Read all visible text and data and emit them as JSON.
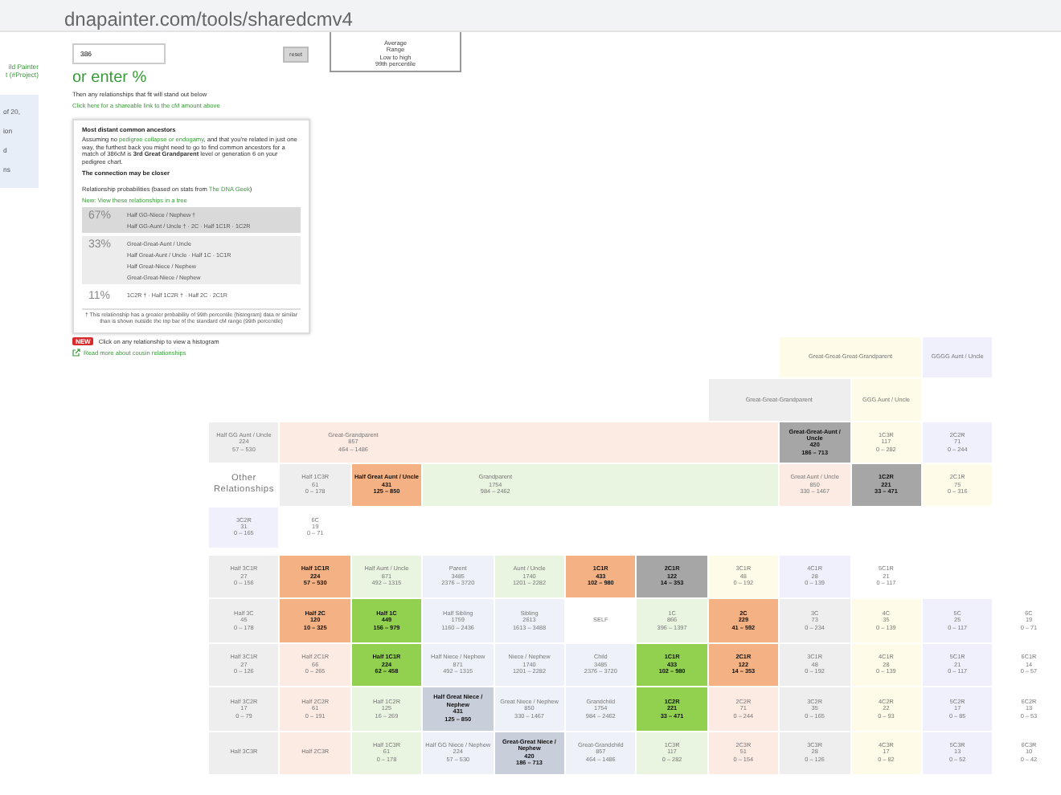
{
  "address_bar": {
    "url": "dnapainter.com/tools/sharedcmv4"
  },
  "sidebar": {
    "links": [
      "ild Painter",
      "t (#Project)"
    ],
    "panel_lines": [
      "of 20,",
      "ion",
      "d",
      "ns"
    ]
  },
  "calculator": {
    "cm_input": {
      "value": "386"
    },
    "reset_button": "reset",
    "legend_lines": [
      "Average",
      "Range",
      "Low to high",
      "99th percentile"
    ],
    "percent_heading": "or enter %",
    "instruction": "Then any relationships that fit will stand out below",
    "share_link": "Click here for a shareable link to the cM amount above",
    "ancestors_box": {
      "title": "Most distant common ancestors",
      "assumption": {
        "before": "Assuming no ",
        "link": "pedigree collapse or endogamy",
        "after": ", and that you're related in just one way, the furthest back you might need to go to find common ancestors for a match of 386cM is **3rd Great Grandparent** level or generation 6 on your pedigree chart."
      },
      "closer_note": "The connection may be closer",
      "probabilities_heading": {
        "before": "Relationship probabilities (based on stats from ",
        "link": "The DNA Geek",
        "after": ")"
      },
      "tree_link": "New: View these relationships in a tree",
      "groups": [
        {
          "percent": "67%",
          "color": "#d9d9d9",
          "lines": [
            "Half GG-Niece / Nephew †",
            "Half GG-Aunt / Uncle †  ·  2C  ·  Half 1C1R  ·  1C2R"
          ]
        },
        {
          "percent": "33%",
          "color": "#ececec",
          "lines": [
            "Great-Great-Aunt / Uncle",
            "Half Great-Aunt / Uncle  ·  Half 1C  ·  1C1R",
            "Half Great-Niece / Nephew",
            "Great-Great-Niece / Nephew"
          ]
        },
        {
          "percent": "11%",
          "color": "#ffffff",
          "lines": [
            "1C2R †  ·  Half 1C2R †  ·  Half 2C  ·  2C1R"
          ]
        }
      ],
      "footnote": "† This relationship has a greater probability of 99th percentile (histogram) data or similar than is shown outside the top bar of the standard cM range (99th percentile)"
    },
    "new_badge": "NEW",
    "histogram_hint": "Click on any relationship to view a histogram",
    "read_more_link": "Read more about cousin relationships"
  },
  "grid": {
    "other_label": "Other Relationships",
    "rows": [
      {
        "cells": [
          null,
          null,
          null,
          null,
          null,
          null,
          null,
          null,
          {
            "name": "Great-Great-Great-Grandparent",
            "color": "#fefbe9",
            "highlighted": false
          },
          null,
          {
            "name": "GGGG Aunt / Uncle",
            "color": "#f0f0fc",
            "highlighted": false
          }
        ]
      },
      {
        "cells": [
          null,
          null,
          null,
          null,
          null,
          null,
          null,
          {
            "name": "Great-Great-Grandparent",
            "color": "#eeeeee",
            "highlighted": false
          },
          null,
          {
            "name": "GGG Aunt / Uncle",
            "color": "#fefbe9",
            "highlighted": false
          }
        ]
      },
      {
        "cells": [
          {
            "name": "Half GG Aunt / Uncle",
            "cm": "224",
            "range": "57 – 530",
            "color": "#eeeeee",
            "highlighted": false
          },
          {
            "name": "Great-Grandparent",
            "cm": "857",
            "range": "464 – 1486",
            "color": "#fcebe3",
            "highlighted": false
          },
          null,
          null,
          null,
          null,
          null,
          null,
          {
            "name": "Great-Great-Aunt / Uncle",
            "cm": "420",
            "range": "186 – 713",
            "color": "#a6a6a6",
            "highlighted": true
          },
          {
            "name": "1C3R",
            "cm": "117",
            "range": "0 – 282",
            "color": "#fefbe9",
            "highlighted": false
          },
          {
            "name": "2C2R",
            "cm": "71",
            "range": "0 – 244",
            "color": "#f0f0fc",
            "highlighted": false
          }
        ]
      },
      {
        "cells": [
          null,
          {
            "name": "Half 1C3R",
            "cm": "61",
            "range": "0 – 178",
            "color": "#eeeeee",
            "highlighted": false
          },
          {
            "name": "Half Great Aunt / Uncle",
            "cm": "431",
            "range": "125 – 850",
            "color": "#f4b183",
            "highlighted": true
          },
          {
            "name": "Grandparent",
            "cm": "1754",
            "range": "984 – 2462",
            "color": "#eaf5e1",
            "highlighted": false
          },
          null,
          null,
          null,
          null,
          {
            "name": "Great Aunt / Uncle",
            "cm": "850",
            "range": "330 – 1467",
            "color": "#fcebe3",
            "highlighted": false
          },
          {
            "name": "1C2R",
            "cm": "221",
            "range": "33 – 471",
            "color": "#a6a6a6",
            "highlighted": true
          },
          {
            "name": "2C1R",
            "cm": "75",
            "range": "0 – 316",
            "color": "#fefbe9",
            "highlighted": false
          }
        ]
      },
      {
        "cells": [
          {
            "name": "3C2R",
            "cm": "31",
            "range": "0 – 165",
            "color": "#f0f0fc",
            "highlighted": false
          },
          {
            "name": "6C",
            "cm": "19",
            "range": "0 – 71",
            "color": "#ffffff",
            "highlighted": false
          }
        ]
      },
      {
        "cells": [
          {
            "name": "Half 3C1R",
            "cm": "27",
            "range": "0 – 156",
            "color": "#eeeeee",
            "highlighted": false
          },
          {
            "name": "Half 1C1R",
            "cm": "224",
            "range": "57 – 530",
            "color": "#f4b183",
            "highlighted": true
          },
          {
            "name": "Half Aunt / Uncle",
            "cm": "871",
            "range": "492 – 1315",
            "color": "#eaf5e1",
            "highlighted": false
          },
          {
            "name": "Parent",
            "cm": "3485",
            "range": "2376 – 3720",
            "color": "#eef2f8",
            "highlighted": false
          },
          {
            "name": "Aunt / Uncle",
            "cm": "1740",
            "range": "1201 – 2282",
            "color": "#eaf5e1",
            "highlighted": false
          },
          {
            "name": "1C1R",
            "cm": "433",
            "range": "102 – 980",
            "color": "#f4b183",
            "highlighted": true
          },
          {
            "name": "2C1R",
            "cm": "122",
            "range": "14 – 353",
            "color": "#a6a6a6",
            "highlighted": true
          },
          {
            "name": "3C1R",
            "cm": "48",
            "range": "0 – 192",
            "color": "#fefbe9",
            "highlighted": false
          },
          {
            "name": "4C1R",
            "cm": "28",
            "range": "0 – 139",
            "color": "#f0f0fc",
            "highlighted": false
          },
          {
            "name": "5C1R",
            "cm": "21",
            "range": "0 – 117",
            "color": "#ffffff",
            "highlighted": false
          }
        ]
      },
      {
        "cells": [
          {
            "name": "Half 3C",
            "cm": "45",
            "range": "0 – 178",
            "color": "#eeeeee",
            "highlighted": false
          },
          {
            "name": "Half 2C",
            "cm": "120",
            "range": "10 – 325",
            "color": "#f4b183",
            "highlighted": true
          },
          {
            "name": "Half 1C",
            "cm": "449",
            "range": "156 – 979",
            "color": "#92d050",
            "highlighted": true
          },
          {
            "name": "Half Sibling",
            "cm": "1759",
            "range": "1160 – 2436",
            "color": "#eef2f8",
            "highlighted": false
          },
          {
            "name": "Sibling",
            "cm": "2613",
            "range": "1613 – 3488",
            "color": "#eef2f8",
            "highlighted": false
          },
          {
            "name": "SELF",
            "color": "#ffffff",
            "highlighted": false
          },
          {
            "name": "1C",
            "cm": "866",
            "range": "396 – 1397",
            "color": "#eaf5e1",
            "highlighted": false
          },
          {
            "name": "2C",
            "cm": "229",
            "range": "41 – 592",
            "color": "#f4b183",
            "highlighted": true
          },
          {
            "name": "3C",
            "cm": "73",
            "range": "0 – 234",
            "color": "#eeeeee",
            "highlighted": false
          },
          {
            "name": "4C",
            "cm": "35",
            "range": "0 – 139",
            "color": "#fefbe9",
            "highlighted": false
          },
          {
            "name": "5C",
            "cm": "25",
            "range": "0 – 117",
            "color": "#f0f0fc",
            "highlighted": false
          },
          {
            "name": "6C",
            "cm": "19",
            "range": "0 – 71",
            "color": "#ffffff",
            "highlighted": false
          }
        ]
      },
      {
        "cells": [
          {
            "name": "Half 3C1R",
            "cm": "27",
            "range": "0 – 126",
            "color": "#eeeeee",
            "highlighted": false
          },
          {
            "name": "Half 2C1R",
            "cm": "66",
            "range": "0 – 265",
            "color": "#fcebe3",
            "highlighted": false
          },
          {
            "name": "Half 1C1R",
            "cm": "224",
            "range": "62 – 458",
            "color": "#92d050",
            "highlighted": true
          },
          {
            "name": "Half Niece / Nephew",
            "cm": "871",
            "range": "492 – 1315",
            "color": "#eef2f8",
            "highlighted": false
          },
          {
            "name": "Niece / Nephew",
            "cm": "1740",
            "range": "1201 – 2282",
            "color": "#eef2f8",
            "highlighted": false
          },
          {
            "name": "Child",
            "cm": "3485",
            "range": "2376 – 3720",
            "color": "#eef2f8",
            "highlighted": false
          },
          {
            "name": "1C1R",
            "cm": "433",
            "range": "102 – 980",
            "color": "#92d050",
            "highlighted": true
          },
          {
            "name": "2C1R",
            "cm": "122",
            "range": "14 – 353",
            "color": "#f4b183",
            "highlighted": true
          },
          {
            "name": "3C1R",
            "cm": "48",
            "range": "0 – 192",
            "color": "#eeeeee",
            "highlighted": false
          },
          {
            "name": "4C1R",
            "cm": "28",
            "range": "0 – 139",
            "color": "#fefbe9",
            "highlighted": false
          },
          {
            "name": "5C1R",
            "cm": "21",
            "range": "0 – 117",
            "color": "#f0f0fc",
            "highlighted": false
          },
          {
            "name": "6C1R",
            "cm": "14",
            "range": "0 – 57",
            "color": "#ffffff",
            "highlighted": false
          }
        ]
      },
      {
        "cells": [
          {
            "name": "Half 3C2R",
            "cm": "17",
            "range": "0 – 79",
            "color": "#eeeeee",
            "highlighted": false
          },
          {
            "name": "Half 2C2R",
            "cm": "61",
            "range": "0 – 191",
            "color": "#fcebe3",
            "highlighted": false
          },
          {
            "name": "Half 1C2R",
            "cm": "125",
            "range": "16 – 269",
            "color": "#eaf5e1",
            "highlighted": false
          },
          {
            "name": "Half Great Niece / Nephew",
            "cm": "431",
            "range": "125 – 850",
            "color": "#c8ceda",
            "highlighted": true
          },
          {
            "name": "Great Niece / Nephew",
            "cm": "850",
            "range": "330 – 1467",
            "color": "#eef2f8",
            "highlighted": false
          },
          {
            "name": "Grandchild",
            "cm": "1754",
            "range": "984 – 2462",
            "color": "#eef2f8",
            "highlighted": false
          },
          {
            "name": "1C2R",
            "cm": "221",
            "range": "33 – 471",
            "color": "#92d050",
            "highlighted": true
          },
          {
            "name": "2C2R",
            "cm": "71",
            "range": "0 – 244",
            "color": "#fcebe3",
            "highlighted": false
          },
          {
            "name": "3C2R",
            "cm": "35",
            "range": "0 – 165",
            "color": "#eeeeee",
            "highlighted": false
          },
          {
            "name": "4C2R",
            "cm": "22",
            "range": "0 – 93",
            "color": "#fefbe9",
            "highlighted": false
          },
          {
            "name": "5C2R",
            "cm": "17",
            "range": "0 – 85",
            "color": "#f0f0fc",
            "highlighted": false
          },
          {
            "name": "6C2R",
            "cm": "13",
            "range": "0 – 53",
            "color": "#ffffff",
            "highlighted": false
          }
        ]
      },
      {
        "cells": [
          {
            "name": "Half 3C3R",
            "color": "#eeeeee",
            "highlighted": false
          },
          {
            "name": "Half 2C3R",
            "color": "#fcebe3",
            "highlighted": false
          },
          {
            "name": "Half 1C3R",
            "cm": "61",
            "range": "0 – 178",
            "color": "#eaf5e1",
            "highlighted": false
          },
          {
            "name": "Half GG Niece / Nephew",
            "cm": "224",
            "range": "57 – 530",
            "color": "#eef2f8",
            "highlighted": false
          },
          {
            "name": "Great-Great Niece / Nephew",
            "cm": "420",
            "range": "186 – 713",
            "color": "#c8ceda",
            "highlighted": true
          },
          {
            "name": "Great-Grandchild",
            "cm": "857",
            "range": "464 – 1486",
            "color": "#eef2f8",
            "highlighted": false
          },
          {
            "name": "1C3R",
            "cm": "117",
            "range": "0 – 282",
            "color": "#eaf5e1",
            "highlighted": false
          },
          {
            "name": "2C3R",
            "cm": "51",
            "range": "0 – 154",
            "color": "#fcebe3",
            "highlighted": false
          },
          {
            "name": "3C3R",
            "cm": "28",
            "range": "0 – 126",
            "color": "#eeeeee",
            "highlighted": false
          },
          {
            "name": "4C3R",
            "cm": "17",
            "range": "0 – 82",
            "color": "#fefbe9",
            "highlighted": false
          },
          {
            "name": "5C3R",
            "cm": "13",
            "range": "0 – 52",
            "color": "#f0f0fc",
            "highlighted": false
          },
          {
            "name": "6C3R",
            "cm": "10",
            "range": "0 – 42",
            "color": "#ffffff",
            "highlighted": false
          }
        ]
      }
    ]
  }
}
